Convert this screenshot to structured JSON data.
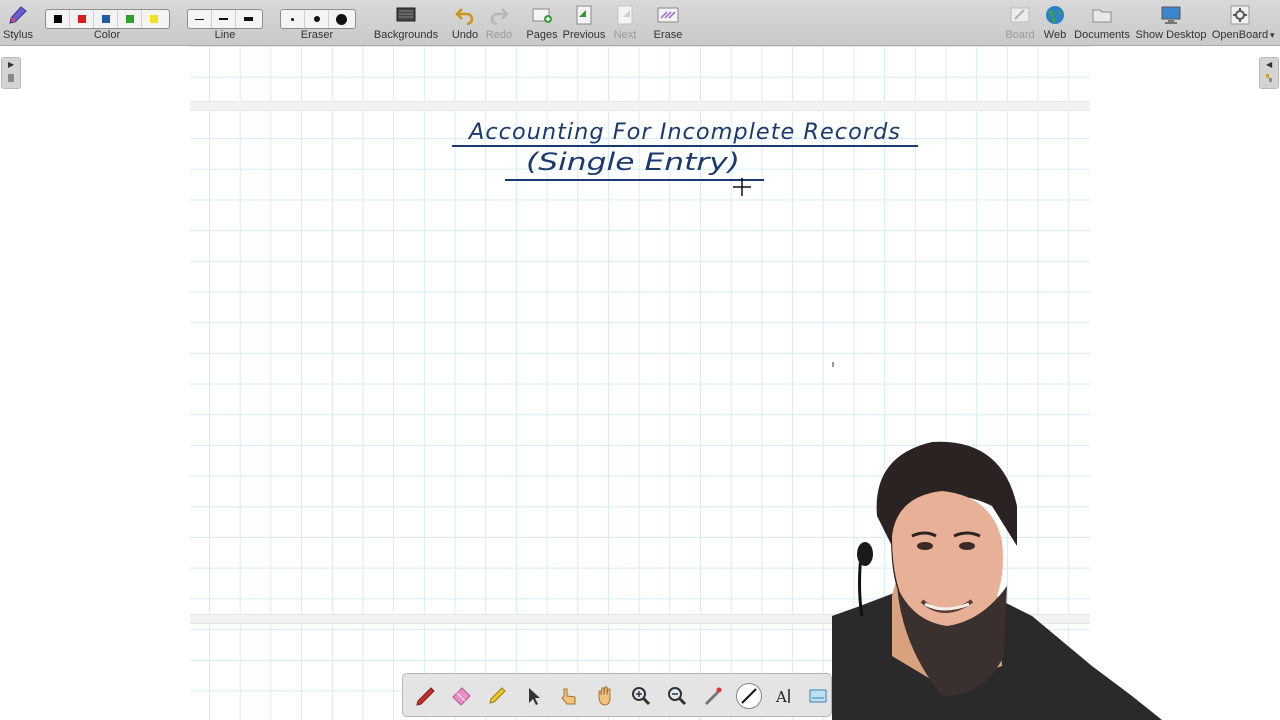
{
  "toolbar": {
    "stylus_label": "Stylus",
    "color_label": "Color",
    "line_label": "Line",
    "eraser_label": "Eraser",
    "backgrounds_label": "Backgrounds",
    "undo_label": "Undo",
    "redo_label": "Redo",
    "pages_label": "Pages",
    "previous_label": "Previous",
    "next_label": "Next",
    "erase_label": "Erase",
    "board_label": "Board",
    "web_label": "Web",
    "documents_label": "Documents",
    "show_desktop_label": "Show Desktop",
    "openboard_label": "OpenBoard",
    "colors": [
      "#000000",
      "#e01b1b",
      "#1f5ca8",
      "#2aa52a",
      "#f2e21b"
    ]
  },
  "board": {
    "title_line1": "Accounting For Incomplete Records",
    "title_line2": "(Single Entry)",
    "ink_color": "#1a3a6e"
  },
  "dock": {
    "tools": [
      "pen-tool",
      "eraser-tool",
      "highlighter-tool",
      "selector-tool",
      "interactor-tool",
      "hand-tool",
      "zoom-in-tool",
      "zoom-out-tool",
      "laser-pointer-tool",
      "line-tool",
      "text-tool",
      "capture-tool"
    ]
  }
}
